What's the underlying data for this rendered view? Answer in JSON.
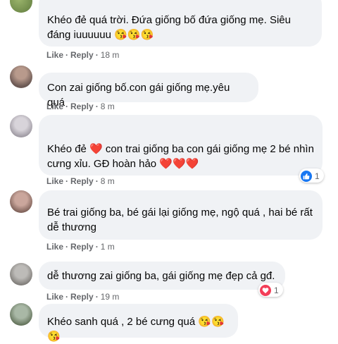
{
  "comments": [
    {
      "text": "Khéo đẻ quá trời. Đứa giống bố đứa giống mẹ. Siêu đáng iuuuuuu 😘😘😘",
      "actions": {
        "like": "Like",
        "reply": "Reply",
        "time": "18 m"
      }
    },
    {
      "text": "Con zai giống bố.con gái giống mẹ.yêu quá",
      "actions": {
        "like": "Like",
        "reply": "Reply",
        "time": "8 m"
      }
    },
    {
      "text": "Khéo đẻ ❤️ con trai giống ba con gái giống mẹ 2 bé nhìn cưng xỉu. GĐ hoàn hảo ❤️❤️❤️",
      "actions": {
        "like": "Like",
        "reply": "Reply",
        "time": "8 m"
      },
      "reaction": {
        "icon": "thumbs-up-icon",
        "count": "1"
      }
    },
    {
      "text": "Bé trai giống ba, bé gái lại giống mẹ, ngộ quá , hai bé rất dễ thương",
      "actions": {
        "like": "Like",
        "reply": "Reply",
        "time": "1 m"
      }
    },
    {
      "text": "dễ thương zai giống ba, gái giống mẹ đẹp cả gđ.",
      "actions": {
        "like": "Like",
        "reply": "Reply",
        "time": "19 m"
      },
      "reaction": {
        "icon": "heart-icon",
        "count": "1"
      }
    },
    {
      "text": "Khéo sanh quá , 2 bé cưng quá 😘😘😘"
    }
  ],
  "colors": {
    "bubble": "#f0f2f5",
    "meta": "#65676b",
    "like_blue": "#1877f2",
    "love_red": "#f33e58"
  }
}
